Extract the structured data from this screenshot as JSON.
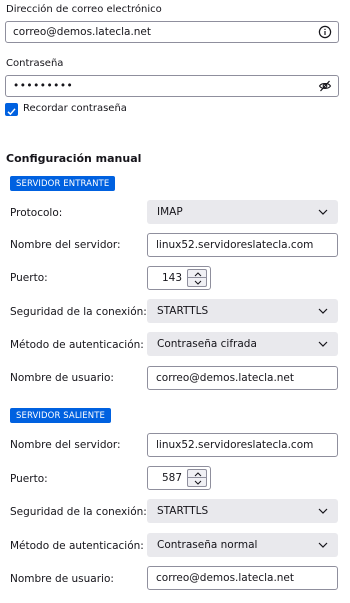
{
  "email": {
    "label": "Dirección de correo electrónico",
    "value": "correo@demos.latecla.net",
    "icon": "info-icon"
  },
  "password": {
    "label": "Contraseña",
    "value": "•••••••••",
    "icon": "eye-slash-icon"
  },
  "remember": {
    "label": "Recordar contraseña",
    "checked": true
  },
  "manual": {
    "title": "Configuración manual"
  },
  "incoming": {
    "badge": "SERVIDOR ENTRANTE",
    "protocol_label": "Protocolo:",
    "protocol_value": "IMAP",
    "hostname_label": "Nombre del servidor:",
    "hostname_value": "linux52.servidoreslatecla.com",
    "port_label": "Puerto:",
    "port_value": "143",
    "security_label": "Seguridad de la conexión:",
    "security_value": "STARTTLS",
    "auth_label": "Método de autenticación:",
    "auth_value": "Contraseña cifrada",
    "username_label": "Nombre de usuario:",
    "username_value": "correo@demos.latecla.net"
  },
  "outgoing": {
    "badge": "SERVIDOR SALIENTE",
    "hostname_label": "Nombre del servidor:",
    "hostname_value": "linux52.servidoreslatecla.com",
    "port_label": "Puerto:",
    "port_value": "587",
    "security_label": "Seguridad de la conexión:",
    "security_value": "STARTTLS",
    "auth_label": "Método de autenticación:",
    "auth_value": "Contraseña normal",
    "username_label": "Nombre de usuario:",
    "username_value": "correo@demos.latecla.net"
  },
  "colors": {
    "accent": "#0061e0",
    "select_bg": "#e9e9ed",
    "border": "#8f8f9d"
  }
}
